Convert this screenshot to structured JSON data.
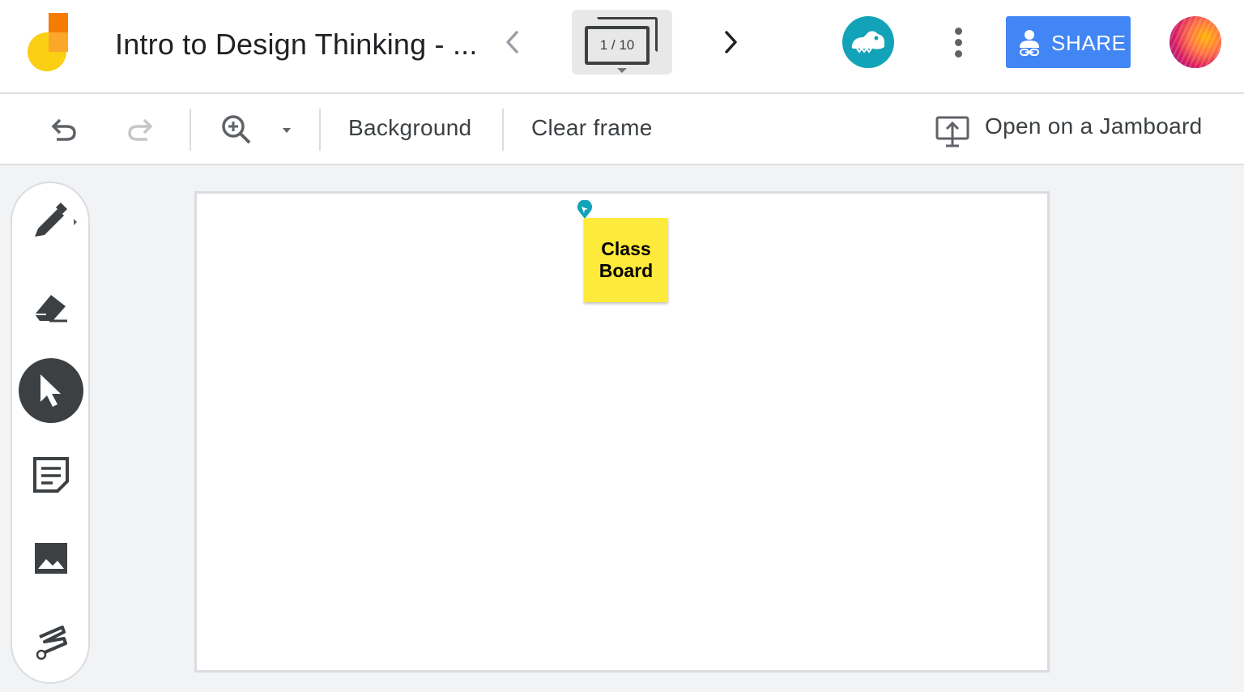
{
  "header": {
    "title": "Intro to Design Thinking - ...",
    "frame_counter": "1 / 10",
    "share_label": "SHARE",
    "accent_color": "#4285f4",
    "extension_color": "#12a3b8"
  },
  "toolbar": {
    "background_label": "Background",
    "clear_frame_label": "Clear frame",
    "open_jamboard_label": "Open on a Jamboard"
  },
  "tools": [
    {
      "name": "pen",
      "icon": "pen-icon"
    },
    {
      "name": "eraser",
      "icon": "eraser-icon"
    },
    {
      "name": "select",
      "icon": "cursor-icon",
      "active": true
    },
    {
      "name": "sticky-note",
      "icon": "sticky-note-icon"
    },
    {
      "name": "image",
      "icon": "image-icon"
    },
    {
      "name": "laser",
      "icon": "laser-icon"
    }
  ],
  "canvas": {
    "sticky_note": {
      "text": "Class\nBoard",
      "color": "#fdea3b"
    }
  }
}
